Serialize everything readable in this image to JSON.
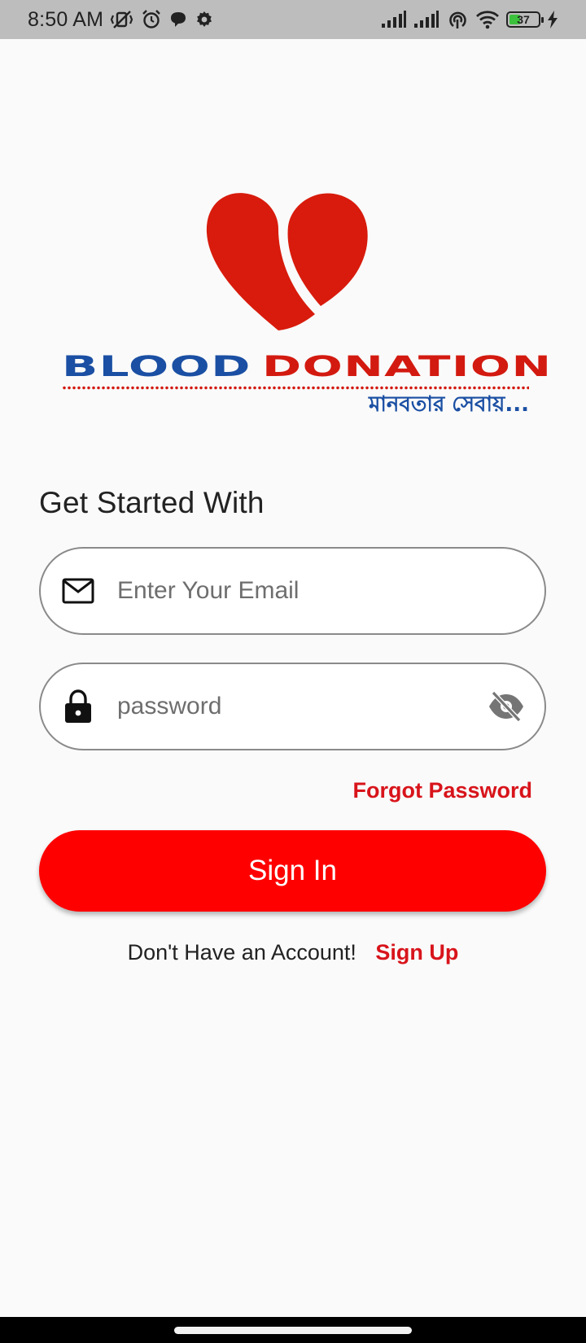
{
  "status_bar": {
    "time": "8:50 AM",
    "battery_level": "37",
    "battery_fraction": 0.37,
    "icons_left": [
      "mute-vibrate-icon",
      "alarm-icon",
      "chat-bubble-icon",
      "settings-gear-icon"
    ],
    "icons_right": [
      "signal-icon",
      "signal-icon",
      "hotspot-icon",
      "wifi-icon",
      "battery-icon",
      "charging-icon"
    ]
  },
  "logo": {
    "word_blood": "BLOOD",
    "word_donation": "DONATION",
    "tagline": "মানবতার সেবায়...",
    "colors": {
      "heart": "#d81b0c",
      "blue": "#1a4fa3",
      "red": "#d31a10"
    }
  },
  "form": {
    "heading": "Get Started With",
    "email": {
      "placeholder": "Enter Your Email",
      "value": "",
      "icon": "mail-icon"
    },
    "password": {
      "placeholder": "password",
      "value": "",
      "icon": "lock-icon",
      "toggle_icon": "eye-off-icon"
    },
    "forgot_password_label": "Forgot Password",
    "sign_in_label": "Sign In",
    "no_account_text": "Don't Have an Account!",
    "sign_up_label": "Sign Up"
  },
  "theme": {
    "primary": "#ff0000",
    "link": "#d8141b",
    "background": "#fafafa",
    "status_bar": "#bdbdbd"
  }
}
